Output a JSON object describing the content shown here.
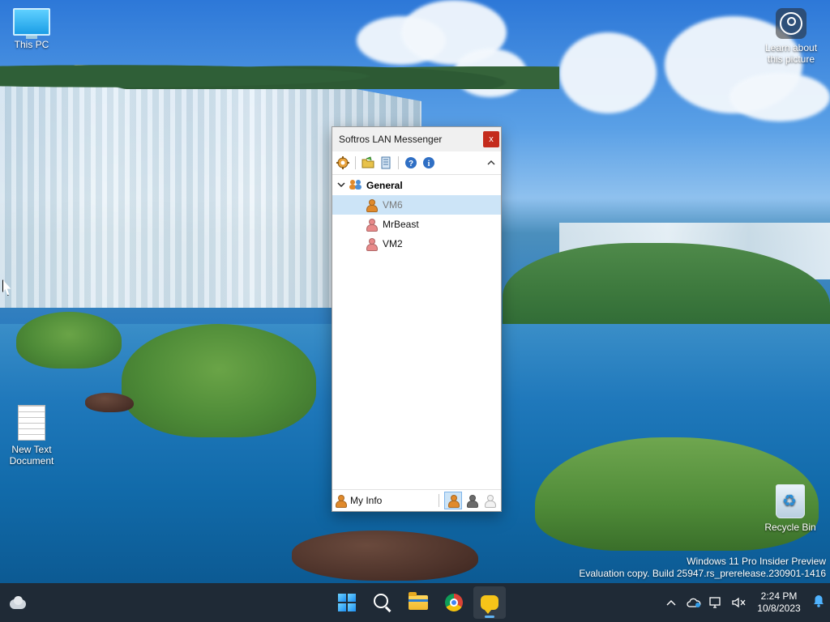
{
  "desktop": {
    "icons": {
      "this_pc": "This PC",
      "new_text_document": "New Text Document",
      "recycle_bin": "Recycle Bin",
      "learn_about": "Learn about this picture"
    },
    "watermark": {
      "line1": "Windows 11 Pro Insider Preview",
      "line2": "Evaluation copy. Build 25947.rs_prerelease.230901-1416"
    }
  },
  "messenger": {
    "title": "Softros LAN Messenger",
    "close_label": "x",
    "toolbar": {
      "icons": [
        "settings-icon",
        "open-folder-icon",
        "message-history-icon",
        "help-icon",
        "info-icon"
      ],
      "collapse_glyph": "^"
    },
    "group": {
      "name": "General",
      "expanded": true
    },
    "contacts": [
      {
        "name": "VM6",
        "status_color": "#e08a2c",
        "selected": true
      },
      {
        "name": "MrBeast",
        "status_color": "#e88a8a",
        "selected": false
      },
      {
        "name": "VM2",
        "status_color": "#e88a8a",
        "selected": false
      }
    ],
    "status_bar": {
      "my_info_label": "My Info",
      "status_buttons": [
        "status-available",
        "status-away",
        "status-offline"
      ],
      "active_status": "status-available"
    }
  },
  "taskbar": {
    "pinned": [
      "start",
      "search",
      "file-explorer",
      "chrome",
      "softros-messenger"
    ],
    "active": "softros-messenger",
    "clock": {
      "time": "2:24 PM",
      "date": "10/8/2023"
    }
  },
  "colors": {
    "selection": "#cce4f7",
    "close_button": "#c42b1c",
    "taskbar": "#1f2a36"
  }
}
